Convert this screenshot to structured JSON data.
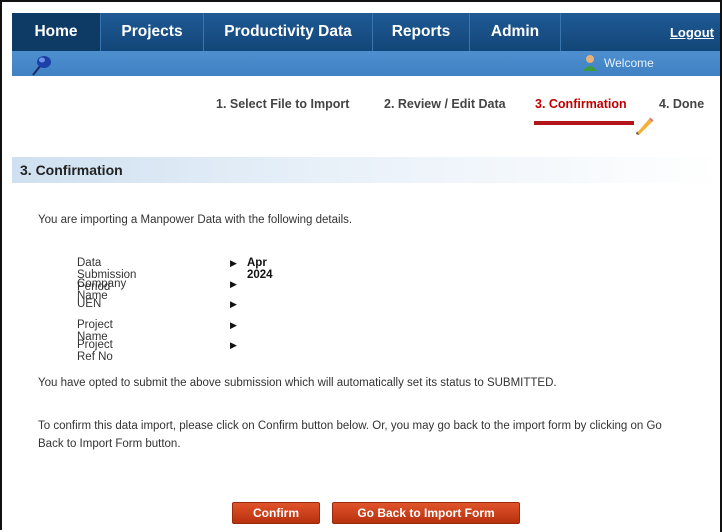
{
  "nav": {
    "home": "Home",
    "projects": "Projects",
    "productivity": "Productivity Data",
    "reports": "Reports",
    "admin": "Admin",
    "logout": "Logout"
  },
  "subbar": {
    "welcome": "Welcome"
  },
  "steps": [
    {
      "label": "1. Select File to Import",
      "active": false
    },
    {
      "label": "2. Review / Edit Data",
      "active": false
    },
    {
      "label": "3. Confirmation",
      "active": true
    },
    {
      "label": "4. Done",
      "active": false
    }
  ],
  "section": {
    "title": "3.  Confirmation"
  },
  "intro": "You are importing a Manpower Data with the following details.",
  "details": [
    {
      "label": "Data Submission Period",
      "value": "Apr 2024"
    },
    {
      "label": "Company Name",
      "value": ""
    },
    {
      "label": "UEN",
      "value": ""
    },
    {
      "label": "Project Name",
      "value": ""
    },
    {
      "label": "Project Ref No",
      "value": ""
    }
  ],
  "status_note": "You have opted to submit the above submission which will automatically set its status to SUBMITTED.",
  "instruction_line1": "To confirm this data import, please click on Confirm button below. Or, you may go back to the import form by clicking on Go",
  "instruction_line2": "Back to Import Form button.",
  "buttons": {
    "confirm": "Confirm",
    "back": "Go Back to Import Form"
  },
  "colors": {
    "nav": "#1a4f86",
    "subbar": "#4588c8",
    "accent": "#c00000",
    "button": "#cc4118"
  },
  "icons": {
    "pin": "pushpin-icon",
    "user": "user-icon",
    "pencil": "pencil-icon"
  }
}
